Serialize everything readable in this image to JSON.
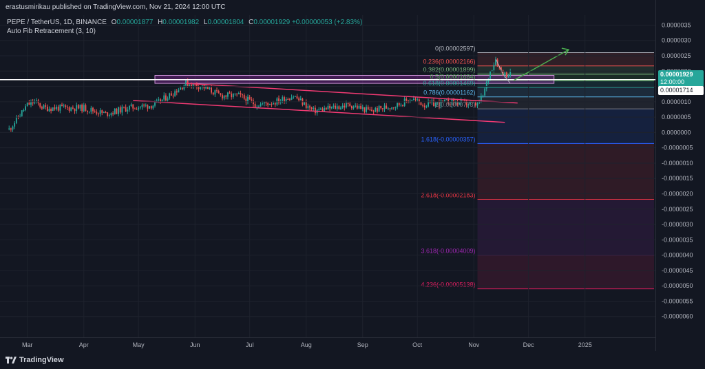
{
  "header": {
    "published": "erastusmirikau published on TradingView.com, Nov 21, 2024 12:00 UTC"
  },
  "legend": {
    "symbol": "PEPE / TetherUS, 1D, BINANCE",
    "open_key": "O",
    "open": "0.00001877",
    "high_key": "H",
    "high": "0.00001982",
    "low_key": "L",
    "low": "0.00001804",
    "close_key": "C",
    "close": "0.00001929",
    "change": "+0.00000053 (+2.83%)",
    "indicator": "Auto Fib Retracement (3, 10)"
  },
  "price_badges": {
    "last_price": "0.00001929",
    "countdown": "12:00:00",
    "line_price": "0.00001714"
  },
  "colors": {
    "background": "#131722",
    "up": "#26a69a",
    "down": "#ef5350",
    "trendline": "#f23a73",
    "zone": "#9c27b0",
    "arrow": "#4caf50",
    "hline": "#ffffff"
  },
  "footer": {
    "brand": "TradingView"
  },
  "chart_data": {
    "type": "candlestick",
    "title": "PEPE / TetherUS, 1D, BINANCE",
    "xlabel": "",
    "ylabel": "",
    "ylim": [
      -6.5e-06,
      3.6e-06
    ],
    "y_ticks": [
      "0.0000035",
      "0.0000030",
      "0.0000025",
      "0.0000020",
      "0.0000015",
      "0.0000010",
      "0.0000005",
      "0.0000000",
      "-0.0000005",
      "-0.0000010",
      "-0.0000015",
      "-0.0000020",
      "-0.0000025",
      "-0.0000030",
      "-0.0000035",
      "-0.0000040",
      "-0.0000045",
      "-0.0000050",
      "-0.0000055",
      "-0.0000060"
    ],
    "x_ticks": [
      "Mar",
      "Apr",
      "May",
      "Jun",
      "Jul",
      "Aug",
      "Sep",
      "Oct",
      "Nov",
      "Dec",
      "2025"
    ],
    "price_points": [
      {
        "date": "2024-02-20",
        "close": 1e-07
      },
      {
        "date": "2024-03-01",
        "close": 9e-07
      },
      {
        "date": "2024-03-05",
        "close": 1e-06
      },
      {
        "date": "2024-03-10",
        "close": 8e-07
      },
      {
        "date": "2024-03-20",
        "close": 8e-07
      },
      {
        "date": "2024-04-01",
        "close": 8e-07
      },
      {
        "date": "2024-04-13",
        "close": 6e-07
      },
      {
        "date": "2024-04-25",
        "close": 8e-07
      },
      {
        "date": "2024-05-10",
        "close": 9e-07
      },
      {
        "date": "2024-05-20",
        "close": 1.3e-06
      },
      {
        "date": "2024-05-27",
        "close": 1.6e-06
      },
      {
        "date": "2024-06-05",
        "close": 1.5e-06
      },
      {
        "date": "2024-06-15",
        "close": 1.2e-06
      },
      {
        "date": "2024-06-25",
        "close": 1.2e-06
      },
      {
        "date": "2024-07-05",
        "close": 9e-07
      },
      {
        "date": "2024-07-15",
        "close": 1e-06
      },
      {
        "date": "2024-07-25",
        "close": 1.2e-06
      },
      {
        "date": "2024-08-05",
        "close": 7e-07
      },
      {
        "date": "2024-08-15",
        "close": 8e-07
      },
      {
        "date": "2024-08-25",
        "close": 9e-07
      },
      {
        "date": "2024-09-05",
        "close": 7e-07
      },
      {
        "date": "2024-09-20",
        "close": 9e-07
      },
      {
        "date": "2024-09-28",
        "close": 1.1e-06
      },
      {
        "date": "2024-10-05",
        "close": 9e-07
      },
      {
        "date": "2024-10-20",
        "close": 1e-06
      },
      {
        "date": "2024-11-03",
        "close": 9e-07
      },
      {
        "date": "2024-11-06",
        "close": 1.2e-06
      },
      {
        "date": "2024-11-10",
        "close": 2e-06
      },
      {
        "date": "2024-11-13",
        "close": 2.4e-06
      },
      {
        "date": "2024-11-15",
        "close": 2.1e-06
      },
      {
        "date": "2024-11-18",
        "close": 1.9e-06
      },
      {
        "date": "2024-11-21",
        "close": 1.9e-06
      }
    ],
    "fib_levels": [
      {
        "ratio": "0",
        "label": "0(0.00002597)",
        "price": 2.6e-06,
        "color": "#b2b5be"
      },
      {
        "ratio": "0.236",
        "label": "0.236(0.00002166)",
        "price": 2.17e-06,
        "color": "#ef5350"
      },
      {
        "ratio": "0.382",
        "label": "0.382(0.00001899)",
        "price": 1.9e-06,
        "color": "#81c784"
      },
      {
        "ratio": "0.5",
        "label": "0.5(0.00001684)",
        "price": 1.68e-06,
        "color": "#4caf50"
      },
      {
        "ratio": "0.618",
        "label": "0.618(0.00001469)",
        "price": 1.47e-06,
        "color": "#26a69a"
      },
      {
        "ratio": "0.786",
        "label": "0.786(0.00001162)",
        "price": 1.16e-06,
        "color": "#5ab4e8"
      },
      {
        "ratio": "1",
        "label": "1(0.00000773)",
        "price": 7.7e-07,
        "color": "#787b86"
      },
      {
        "ratio": "1.618",
        "label": "1.618(-0.00000357)",
        "price": -3.6e-07,
        "color": "#2962ff"
      },
      {
        "ratio": "2.618",
        "label": "2.618(-0.00002183)",
        "price": -2.18e-06,
        "color": "#f23645"
      },
      {
        "ratio": "3.618",
        "label": "3.618(-0.00004009)",
        "price": -4e-06,
        "color": "#9c27b0"
      },
      {
        "ratio": "4.236",
        "label": "4.236(-0.00005138)",
        "price": -5.1e-06,
        "color": "#e91e63"
      }
    ],
    "horizontal_line": 1.72e-06,
    "resistance_zone": [
      1.6e-06,
      1.86e-06
    ],
    "grid": true,
    "legend_position": "top-left"
  }
}
